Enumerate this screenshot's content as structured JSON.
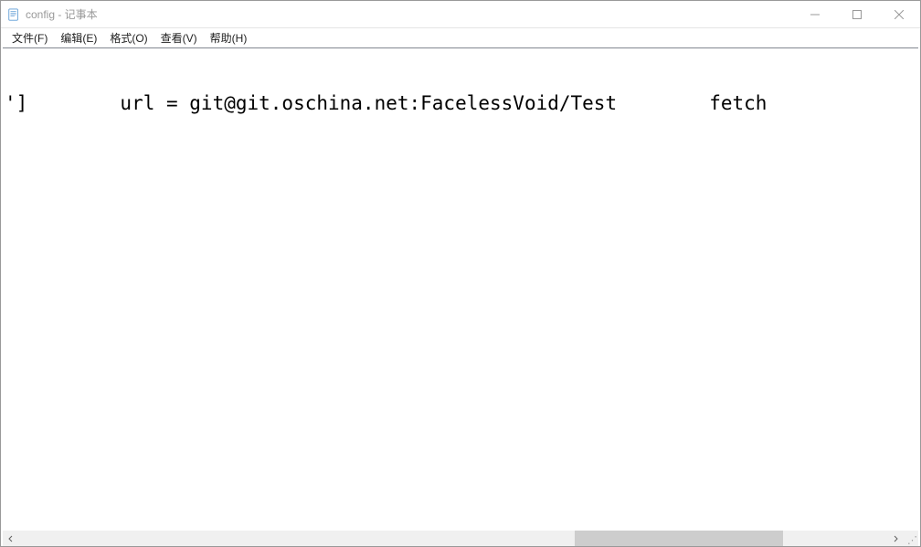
{
  "window": {
    "title": "config - 记事本"
  },
  "menu": {
    "file": "文件(F)",
    "edit": "编辑(E)",
    "format": "格式(O)",
    "view": "查看(V)",
    "help": "帮助(H)"
  },
  "editor": {
    "content": "']        url = git@git.oschina.net:FacelessVoid/Test        fetch "
  }
}
